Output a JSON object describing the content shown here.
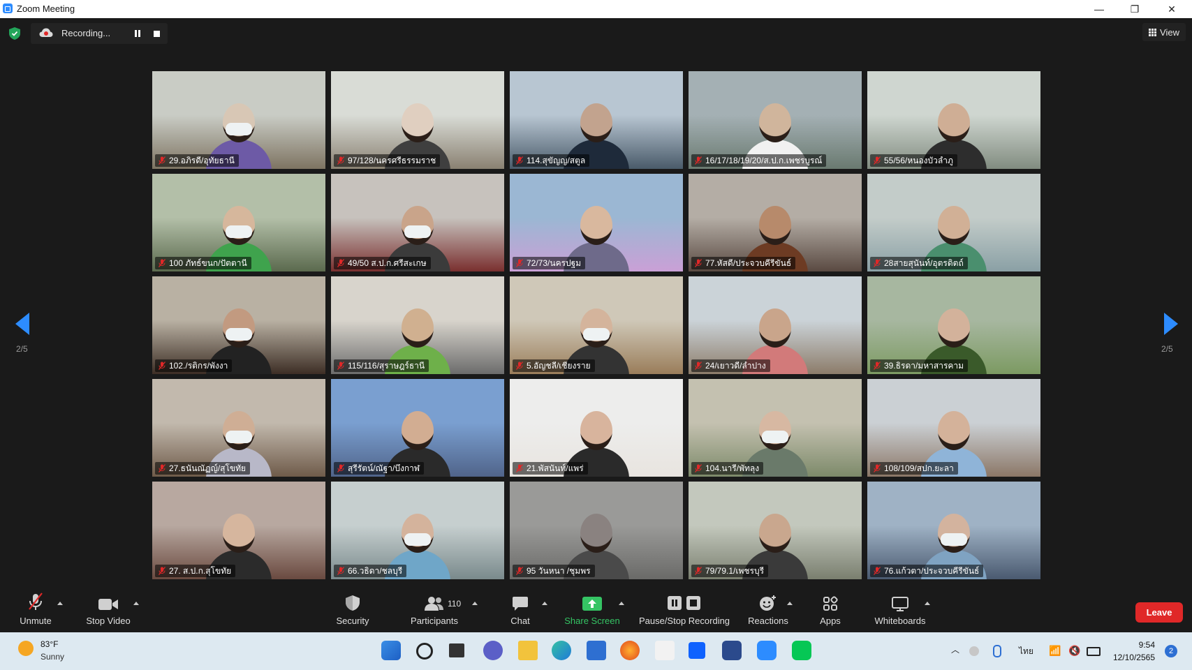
{
  "window": {
    "title": "Zoom Meeting",
    "controls": [
      "—",
      "❐",
      "✕"
    ]
  },
  "topbar": {
    "recording_label": "Recording...",
    "view_label": "View",
    "accent": "#2d8cff"
  },
  "pager": {
    "left": "2/5",
    "right": "2/5"
  },
  "participants": [
    "29.อภิรดี/อุทัยธานี",
    "97/128/นครศรีธรรมราช",
    "114.สุขัญญ/สตูล",
    "16/17/18/19/20/ส.ป.ก.เพชรบูรณ์",
    "55/56/หนองบัวลำภู",
    "100 ภัทธ์ขนก/ปัตตานี",
    "49/50 ส.ป.ก.ศรีสะเกษ",
    "72/73/นครปฐม",
    "77.หัสดี/ประจวบคีรีขันธ์",
    "28สายสุนันท์/อุตรดิตถ์",
    "102./รติกร/พังงา",
    "115/116/สุราษฎร์ธานี",
    "5.อัญชลี/เชียงราย",
    "24/เยาวดี/ลำปาง",
    "39.ธิรดา/มหาสารคาม",
    "27.ธนันณัฏญ์/สุโขทัย",
    "สุรีรัตน์/ณัฐา/บึงกาฬ",
    "21.พัสนันท์/แพร่",
    "104.นารี/พัทลุง",
    "108/109/สปก.ยะลา",
    "27. ส.ป.ก.สุโขทัย",
    "66.วธิดา/ชลบุรี",
    "95 วันหนา /ชุมพร",
    "79/79.1/เพชรบุรี",
    "76.แก้วตา/ประจวบคีรีขันธ์"
  ],
  "toolbar": {
    "unmute": "Unmute",
    "stop_video": "Stop Video",
    "security": "Security",
    "participants": "Participants",
    "participants_count": "110",
    "chat": "Chat",
    "share_screen": "Share Screen",
    "pause_stop_recording": "Pause/Stop Recording",
    "reactions": "Reactions",
    "apps": "Apps",
    "whiteboards": "Whiteboards",
    "leave": "Leave",
    "share_color": "#35c464",
    "leave_color": "#e02828"
  },
  "taskbar": {
    "weather_temp": "83°F",
    "weather_condition": "Sunny",
    "language": "ไทย",
    "time": "9:54",
    "date": "12/10/2565",
    "notification_count": "2"
  }
}
